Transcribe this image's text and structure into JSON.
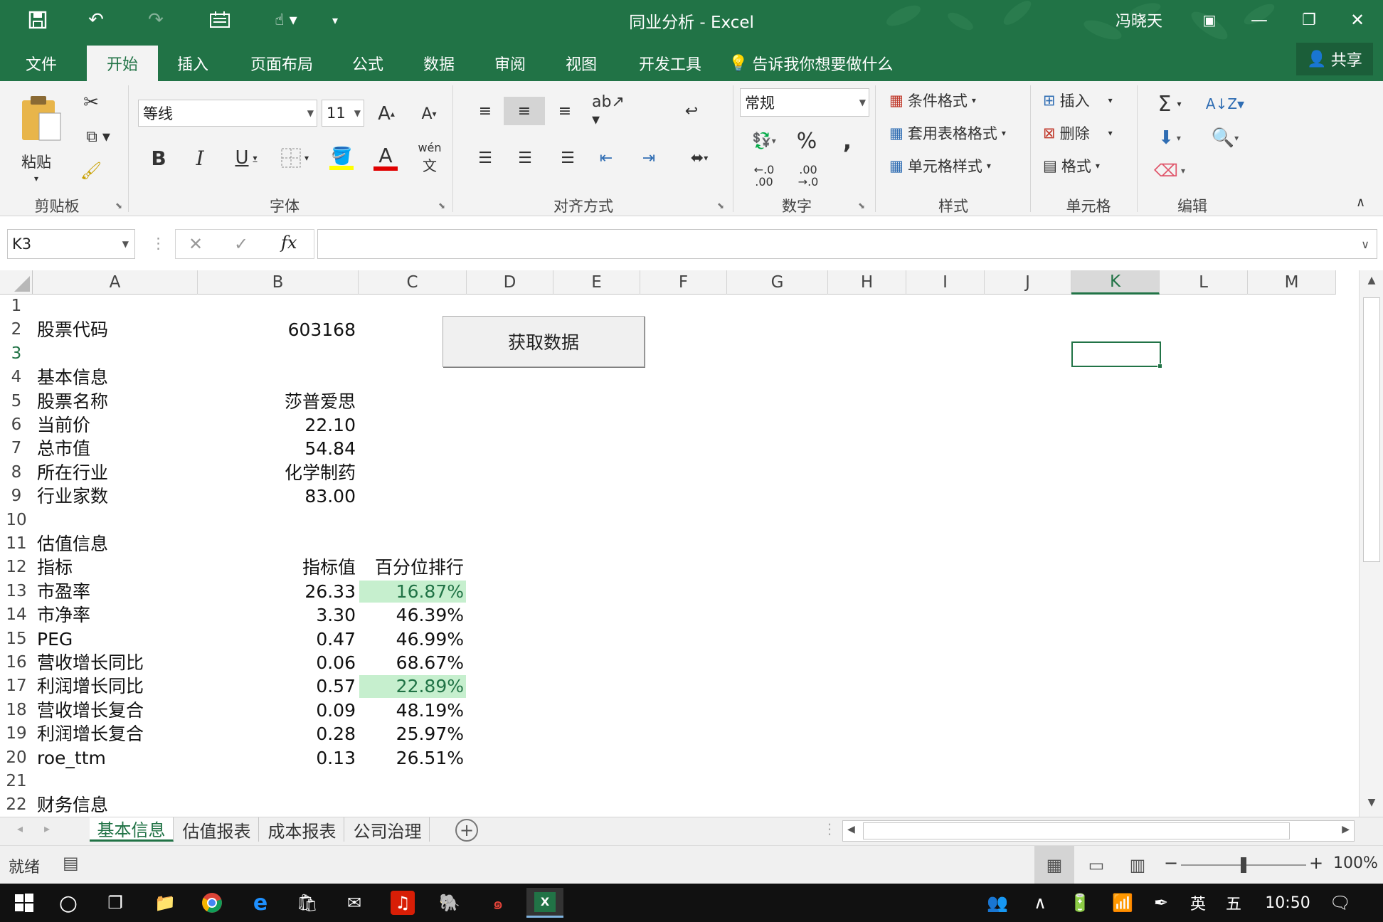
{
  "window": {
    "title": "同业分析 - Excel",
    "user": "冯晓天"
  },
  "tabs": [
    {
      "label": "文件",
      "active": false
    },
    {
      "label": "开始",
      "active": true
    },
    {
      "label": "插入",
      "active": false
    },
    {
      "label": "页面布局",
      "active": false
    },
    {
      "label": "公式",
      "active": false
    },
    {
      "label": "数据",
      "active": false
    },
    {
      "label": "审阅",
      "active": false
    },
    {
      "label": "视图",
      "active": false
    },
    {
      "label": "开发工具",
      "active": false
    }
  ],
  "tell_me": "告诉我你想要做什么",
  "share": "共享",
  "ribbon": {
    "clipboard": {
      "paste": "粘贴",
      "label": "剪贴板"
    },
    "font": {
      "name": "等线",
      "size": "11",
      "label": "字体",
      "phonetic": "wén"
    },
    "alignment": {
      "label": "对齐方式"
    },
    "number": {
      "format": "常规",
      "percent": "%",
      "comma": ",",
      "label": "数字",
      "inc_decimal": "←.0\n.00",
      "dec_decimal": ".00\n→.0"
    },
    "styles": {
      "conditional": "条件格式",
      "table": "套用表格格式",
      "cell": "单元格样式",
      "label": "样式"
    },
    "cells": {
      "insert": "插入",
      "delete": "删除",
      "format": "格式",
      "label": "单元格"
    },
    "editing": {
      "label": "编辑",
      "sum": "Σ"
    }
  },
  "formula_bar": {
    "name_box": "K3",
    "fx": "fx",
    "value": ""
  },
  "columns": [
    "A",
    "B",
    "C",
    "D",
    "E",
    "F",
    "G",
    "H",
    "I",
    "J",
    "K",
    "L",
    "M"
  ],
  "selected_column": "K",
  "rows": [
    "1",
    "2",
    "3",
    "4",
    "5",
    "6",
    "7",
    "8",
    "9",
    "10",
    "11",
    "12",
    "13",
    "14",
    "15",
    "16",
    "17",
    "18",
    "19",
    "20",
    "21",
    "22"
  ],
  "selected_row": "3",
  "cells": {
    "a2": "股票代码",
    "b2": "603168",
    "a4": "基本信息",
    "a5": "股票名称",
    "b5": "莎普爱思",
    "a6": "当前价",
    "b6": "22.10",
    "a7": "总市值",
    "b7": "54.84",
    "a8": "所在行业",
    "b8": "化学制药",
    "a9": "行业家数",
    "b9": "83.00",
    "a11": "估值信息",
    "a12": "指标",
    "b12": "指标值",
    "c12": "百分位排行",
    "a13": "市盈率",
    "b13": "26.33",
    "c13": "16.87%",
    "a14": "市净率",
    "b14": "3.30",
    "c14": "46.39%",
    "a15": "PEG",
    "b15": "0.47",
    "c15": "46.99%",
    "a16": "营收增长同比",
    "b16": "0.06",
    "c16": "68.67%",
    "a17": "利润增长同比",
    "b17": "0.57",
    "c17": "22.89%",
    "a18": "营收增长复合",
    "b18": "0.09",
    "c18": "48.19%",
    "a19": "利润增长复合",
    "b19": "0.28",
    "c19": "25.97%",
    "a20": "roe_ttm",
    "b20": "0.13",
    "c20": "26.51%",
    "a22": "财务信息"
  },
  "highlight_color": "#c6efce",
  "highlight_text_color": "#217346",
  "button": {
    "label": "获取数据"
  },
  "sheets": [
    {
      "label": "基本信息",
      "active": true
    },
    {
      "label": "估值报表",
      "active": false
    },
    {
      "label": "成本报表",
      "active": false
    },
    {
      "label": "公司治理",
      "active": false
    }
  ],
  "status": {
    "ready": "就绪",
    "zoom": "100%"
  },
  "taskbar": {
    "ime_lang": "英",
    "ime_mode": "五",
    "time": "10:50"
  },
  "colors": {
    "accent": "#217346"
  }
}
